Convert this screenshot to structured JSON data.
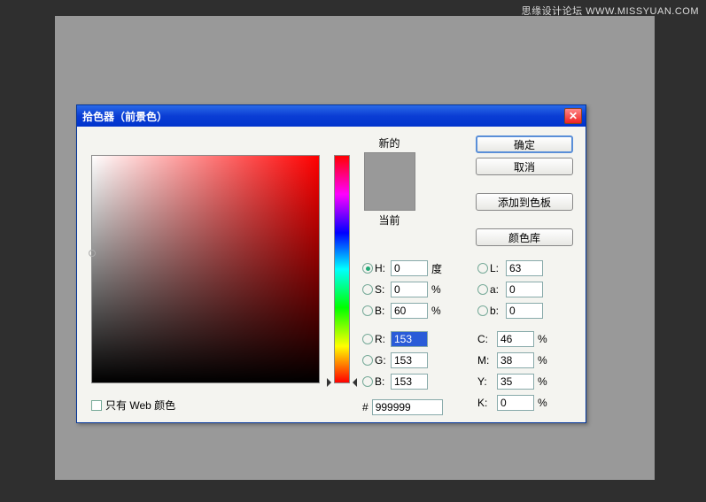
{
  "watermark": "思缘设计论坛  WWW.MISSYUAN.COM",
  "dialog": {
    "title": "拾色器（前景色）",
    "new_label": "新的",
    "current_label": "当前",
    "ok": "确定",
    "cancel": "取消",
    "add_swatch": "添加到色板",
    "color_libs": "颜色库",
    "web_only": "只有 Web 颜色",
    "hex_prefix": "#",
    "hex_value": "999999"
  },
  "hsb": {
    "h_label": "H:",
    "h": "0",
    "h_unit": "度",
    "s_label": "S:",
    "s": "0",
    "s_unit": "%",
    "b_label": "B:",
    "b": "60",
    "b_unit": "%"
  },
  "rgb": {
    "r_label": "R:",
    "r": "153",
    "g_label": "G:",
    "g": "153",
    "b_label": "B:",
    "b": "153"
  },
  "lab": {
    "l_label": "L:",
    "l": "63",
    "a_label": "a:",
    "a": "0",
    "b_label": "b:",
    "b": "0"
  },
  "cmyk": {
    "c_label": "C:",
    "c": "46",
    "unit": "%",
    "m_label": "M:",
    "m": "38",
    "y_label": "Y:",
    "y": "35",
    "k_label": "K:",
    "k": "0"
  }
}
